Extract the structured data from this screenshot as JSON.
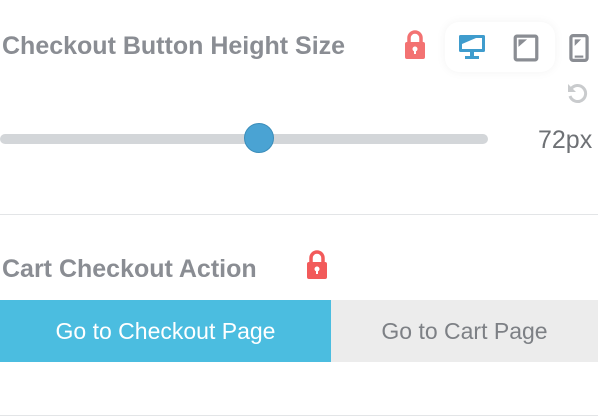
{
  "height_setting": {
    "label": "Checkout Button Height Size",
    "value": 72,
    "unit": "px",
    "value_text": "72px",
    "slider_fraction": 0.53,
    "devices": [
      "desktop-icon",
      "tablet-icon",
      "mobile-icon"
    ],
    "active_device": "desktop"
  },
  "action_setting": {
    "label": "Cart Checkout Action",
    "options": [
      "Go to Checkout Page",
      "Go to Cart Page"
    ],
    "selected": 0
  },
  "colors": {
    "accent": "#4bbde0",
    "lock": "#f25a5a",
    "slider": "#4aa3d3"
  }
}
